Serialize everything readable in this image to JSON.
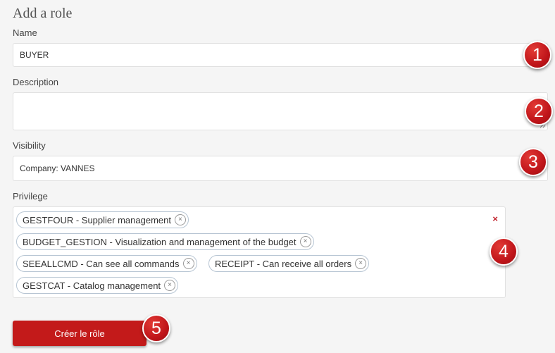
{
  "form": {
    "title": "Add a role",
    "name": {
      "label": "Name",
      "value": "BUYER"
    },
    "description": {
      "label": "Description",
      "value": ""
    },
    "visibility": {
      "label": "Visibility",
      "value": "Company: VANNES"
    },
    "privilege": {
      "label": "Privilege",
      "clear_icon": "×",
      "tags": [
        {
          "label": "GESTFOUR - Supplier management",
          "remove": "×"
        },
        {
          "label": "BUDGET_GESTION - Visualization and management of the budget",
          "remove": "×"
        },
        {
          "label": "SEEALLCMD - Can see all commands",
          "remove": "×"
        },
        {
          "label": "RECEIPT - Can receive all orders",
          "remove": "×"
        },
        {
          "label": "GESTCAT - Catalog management",
          "remove": "×"
        }
      ]
    },
    "submit_label": "Créer le rôle"
  },
  "annotations": [
    "1",
    "2",
    "3",
    "4",
    "5"
  ],
  "colors": {
    "accent": "#c31a1a",
    "badge": "#c0151a",
    "tag_border": "#b7c5d3"
  }
}
